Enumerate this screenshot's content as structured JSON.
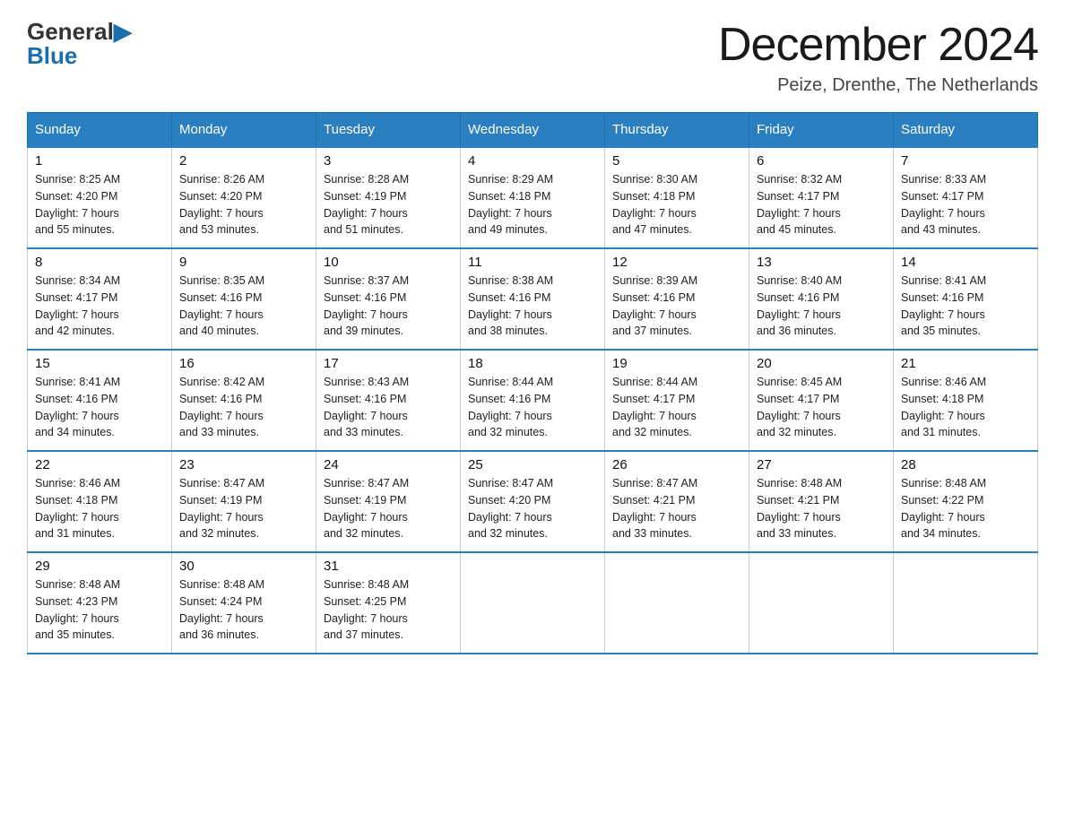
{
  "header": {
    "logo_general": "General",
    "logo_blue": "Blue",
    "month_year": "December 2024",
    "location": "Peize, Drenthe, The Netherlands"
  },
  "days_of_week": [
    "Sunday",
    "Monday",
    "Tuesday",
    "Wednesday",
    "Thursday",
    "Friday",
    "Saturday"
  ],
  "weeks": [
    [
      {
        "day": "1",
        "sunrise": "Sunrise: 8:25 AM",
        "sunset": "Sunset: 4:20 PM",
        "daylight": "Daylight: 7 hours",
        "daylight2": "and 55 minutes."
      },
      {
        "day": "2",
        "sunrise": "Sunrise: 8:26 AM",
        "sunset": "Sunset: 4:20 PM",
        "daylight": "Daylight: 7 hours",
        "daylight2": "and 53 minutes."
      },
      {
        "day": "3",
        "sunrise": "Sunrise: 8:28 AM",
        "sunset": "Sunset: 4:19 PM",
        "daylight": "Daylight: 7 hours",
        "daylight2": "and 51 minutes."
      },
      {
        "day": "4",
        "sunrise": "Sunrise: 8:29 AM",
        "sunset": "Sunset: 4:18 PM",
        "daylight": "Daylight: 7 hours",
        "daylight2": "and 49 minutes."
      },
      {
        "day": "5",
        "sunrise": "Sunrise: 8:30 AM",
        "sunset": "Sunset: 4:18 PM",
        "daylight": "Daylight: 7 hours",
        "daylight2": "and 47 minutes."
      },
      {
        "day": "6",
        "sunrise": "Sunrise: 8:32 AM",
        "sunset": "Sunset: 4:17 PM",
        "daylight": "Daylight: 7 hours",
        "daylight2": "and 45 minutes."
      },
      {
        "day": "7",
        "sunrise": "Sunrise: 8:33 AM",
        "sunset": "Sunset: 4:17 PM",
        "daylight": "Daylight: 7 hours",
        "daylight2": "and 43 minutes."
      }
    ],
    [
      {
        "day": "8",
        "sunrise": "Sunrise: 8:34 AM",
        "sunset": "Sunset: 4:17 PM",
        "daylight": "Daylight: 7 hours",
        "daylight2": "and 42 minutes."
      },
      {
        "day": "9",
        "sunrise": "Sunrise: 8:35 AM",
        "sunset": "Sunset: 4:16 PM",
        "daylight": "Daylight: 7 hours",
        "daylight2": "and 40 minutes."
      },
      {
        "day": "10",
        "sunrise": "Sunrise: 8:37 AM",
        "sunset": "Sunset: 4:16 PM",
        "daylight": "Daylight: 7 hours",
        "daylight2": "and 39 minutes."
      },
      {
        "day": "11",
        "sunrise": "Sunrise: 8:38 AM",
        "sunset": "Sunset: 4:16 PM",
        "daylight": "Daylight: 7 hours",
        "daylight2": "and 38 minutes."
      },
      {
        "day": "12",
        "sunrise": "Sunrise: 8:39 AM",
        "sunset": "Sunset: 4:16 PM",
        "daylight": "Daylight: 7 hours",
        "daylight2": "and 37 minutes."
      },
      {
        "day": "13",
        "sunrise": "Sunrise: 8:40 AM",
        "sunset": "Sunset: 4:16 PM",
        "daylight": "Daylight: 7 hours",
        "daylight2": "and 36 minutes."
      },
      {
        "day": "14",
        "sunrise": "Sunrise: 8:41 AM",
        "sunset": "Sunset: 4:16 PM",
        "daylight": "Daylight: 7 hours",
        "daylight2": "and 35 minutes."
      }
    ],
    [
      {
        "day": "15",
        "sunrise": "Sunrise: 8:41 AM",
        "sunset": "Sunset: 4:16 PM",
        "daylight": "Daylight: 7 hours",
        "daylight2": "and 34 minutes."
      },
      {
        "day": "16",
        "sunrise": "Sunrise: 8:42 AM",
        "sunset": "Sunset: 4:16 PM",
        "daylight": "Daylight: 7 hours",
        "daylight2": "and 33 minutes."
      },
      {
        "day": "17",
        "sunrise": "Sunrise: 8:43 AM",
        "sunset": "Sunset: 4:16 PM",
        "daylight": "Daylight: 7 hours",
        "daylight2": "and 33 minutes."
      },
      {
        "day": "18",
        "sunrise": "Sunrise: 8:44 AM",
        "sunset": "Sunset: 4:16 PM",
        "daylight": "Daylight: 7 hours",
        "daylight2": "and 32 minutes."
      },
      {
        "day": "19",
        "sunrise": "Sunrise: 8:44 AM",
        "sunset": "Sunset: 4:17 PM",
        "daylight": "Daylight: 7 hours",
        "daylight2": "and 32 minutes."
      },
      {
        "day": "20",
        "sunrise": "Sunrise: 8:45 AM",
        "sunset": "Sunset: 4:17 PM",
        "daylight": "Daylight: 7 hours",
        "daylight2": "and 32 minutes."
      },
      {
        "day": "21",
        "sunrise": "Sunrise: 8:46 AM",
        "sunset": "Sunset: 4:18 PM",
        "daylight": "Daylight: 7 hours",
        "daylight2": "and 31 minutes."
      }
    ],
    [
      {
        "day": "22",
        "sunrise": "Sunrise: 8:46 AM",
        "sunset": "Sunset: 4:18 PM",
        "daylight": "Daylight: 7 hours",
        "daylight2": "and 31 minutes."
      },
      {
        "day": "23",
        "sunrise": "Sunrise: 8:47 AM",
        "sunset": "Sunset: 4:19 PM",
        "daylight": "Daylight: 7 hours",
        "daylight2": "and 32 minutes."
      },
      {
        "day": "24",
        "sunrise": "Sunrise: 8:47 AM",
        "sunset": "Sunset: 4:19 PM",
        "daylight": "Daylight: 7 hours",
        "daylight2": "and 32 minutes."
      },
      {
        "day": "25",
        "sunrise": "Sunrise: 8:47 AM",
        "sunset": "Sunset: 4:20 PM",
        "daylight": "Daylight: 7 hours",
        "daylight2": "and 32 minutes."
      },
      {
        "day": "26",
        "sunrise": "Sunrise: 8:47 AM",
        "sunset": "Sunset: 4:21 PM",
        "daylight": "Daylight: 7 hours",
        "daylight2": "and 33 minutes."
      },
      {
        "day": "27",
        "sunrise": "Sunrise: 8:48 AM",
        "sunset": "Sunset: 4:21 PM",
        "daylight": "Daylight: 7 hours",
        "daylight2": "and 33 minutes."
      },
      {
        "day": "28",
        "sunrise": "Sunrise: 8:48 AM",
        "sunset": "Sunset: 4:22 PM",
        "daylight": "Daylight: 7 hours",
        "daylight2": "and 34 minutes."
      }
    ],
    [
      {
        "day": "29",
        "sunrise": "Sunrise: 8:48 AM",
        "sunset": "Sunset: 4:23 PM",
        "daylight": "Daylight: 7 hours",
        "daylight2": "and 35 minutes."
      },
      {
        "day": "30",
        "sunrise": "Sunrise: 8:48 AM",
        "sunset": "Sunset: 4:24 PM",
        "daylight": "Daylight: 7 hours",
        "daylight2": "and 36 minutes."
      },
      {
        "day": "31",
        "sunrise": "Sunrise: 8:48 AM",
        "sunset": "Sunset: 4:25 PM",
        "daylight": "Daylight: 7 hours",
        "daylight2": "and 37 minutes."
      },
      null,
      null,
      null,
      null
    ]
  ]
}
